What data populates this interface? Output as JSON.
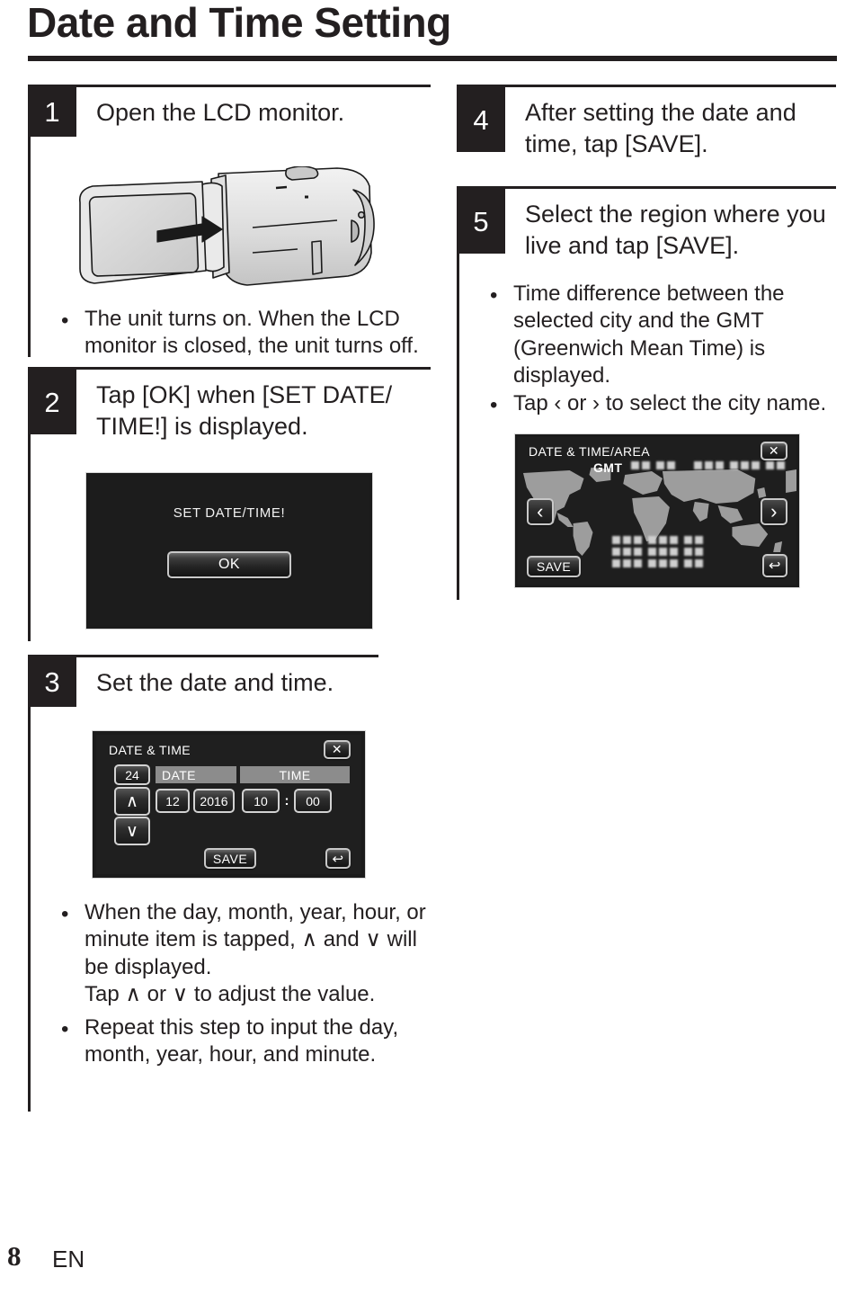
{
  "document": {
    "title": "Date and Time Setting",
    "footer": {
      "page_number": "8",
      "language": "EN"
    }
  },
  "steps": [
    {
      "number": "1",
      "text": "Open the LCD monitor.",
      "notes": [
        "The unit turns on. When the LCD monitor is closed, the unit turns off."
      ]
    },
    {
      "number": "2",
      "text": "Tap [OK] when [SET DATE/ TIME!] is displayed."
    },
    {
      "number": "3",
      "text": "Set the date and time.",
      "notes": [
        "When the day, month, year, hour, or minute item is tapped, ∧ and ∨ will be displayed.",
        "Repeat this step to input the day, month, year, hour, and minute."
      ],
      "note_sub": "Tap ∧ or ∨ to adjust the value."
    },
    {
      "number": "4",
      "text": "After setting the date and time, tap [SAVE]."
    },
    {
      "number": "5",
      "text": "Select the region where you live and tap [SAVE].",
      "notes": [
        "Time difference between the selected city and the GMT (Greenwich Mean Time) is displayed.",
        "Tap ‹ or › to select the city name."
      ]
    }
  ],
  "screens": {
    "set_date_time_dialog": {
      "message": "SET DATE/TIME!",
      "ok_label": "OK"
    },
    "date_time_screen": {
      "title": "DATE & TIME",
      "clock_mode": "24",
      "date_header": "DATE",
      "time_header": "TIME",
      "day": "12",
      "year": "2016",
      "hour": "10",
      "separator": ":",
      "minute": "00",
      "save_label": "SAVE",
      "up_arrow": "∧",
      "down_arrow": "∨",
      "close_glyph": "✕",
      "back_glyph": "↩"
    },
    "area_screen": {
      "title": "DATE & TIME/AREA",
      "gmt_label": "GMT",
      "prev_glyph": "‹",
      "next_glyph": "›",
      "save_label": "SAVE",
      "close_glyph": "✕",
      "back_glyph": "↩"
    }
  },
  "colors": {
    "ink": "#231f20",
    "screen_background": "#1f1f1f",
    "header_bar": "#8c8c8c"
  }
}
